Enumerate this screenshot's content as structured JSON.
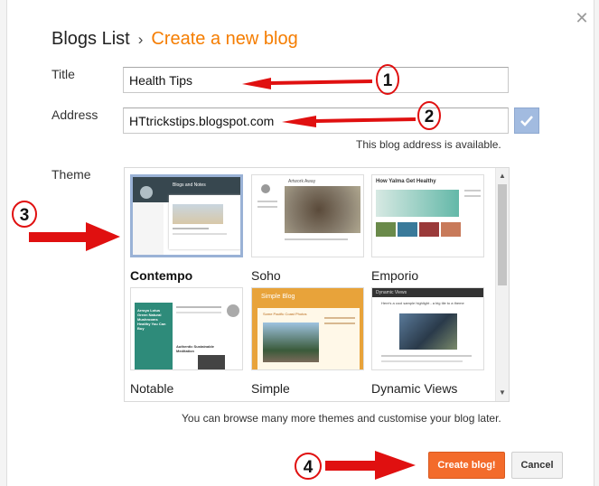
{
  "header": {
    "root": "Blogs List",
    "separator": "›",
    "current": "Create a new blog"
  },
  "form": {
    "title_label": "Title",
    "title_value": "Health Tips",
    "address_label": "Address",
    "address_value": "HTtrickstips.blogspot.com",
    "address_status": "This blog address is available.",
    "theme_label": "Theme"
  },
  "themes": [
    {
      "name": "Contempo",
      "selected": true
    },
    {
      "name": "Soho",
      "selected": false
    },
    {
      "name": "Emporio",
      "selected": false
    },
    {
      "name": "Notable",
      "selected": false
    },
    {
      "name": "Simple",
      "selected": false
    },
    {
      "name": "Dynamic Views",
      "selected": false
    }
  ],
  "thumb_text": {
    "contempo_title": "Blogs and Notes",
    "soho_title": "Artwork Away",
    "emporio_title": "How Yalma Get Healthy",
    "notable_heading": "Arroyo Lotus Green Natural Mushrooms Healthy You Can Buy",
    "notable_sub": "Authentic Sustainable Meditation",
    "simple_title": "Simple Blog",
    "simple_post": "Some Pacific Coast Photos",
    "dynamic_title": "Dynamic Views",
    "dynamic_post": "Here's a cool sample highlight - a big tile to a theme"
  },
  "theme_hint": "You can browse many more themes and customise your blog later.",
  "buttons": {
    "create": "Create blog!",
    "cancel": "Cancel"
  },
  "annotations": [
    "1",
    "2",
    "3",
    "4"
  ],
  "colors": {
    "accent_orange": "#f57d00",
    "primary_button": "#f36b2b",
    "annotation_red": "#e01010",
    "selected_border": "#9ab2d6"
  },
  "icons": {
    "close": "close-icon",
    "check": "check-icon",
    "scroll_up": "arrow-up-icon",
    "scroll_down": "arrow-down-icon",
    "annotation": "right-arrow-icon"
  }
}
